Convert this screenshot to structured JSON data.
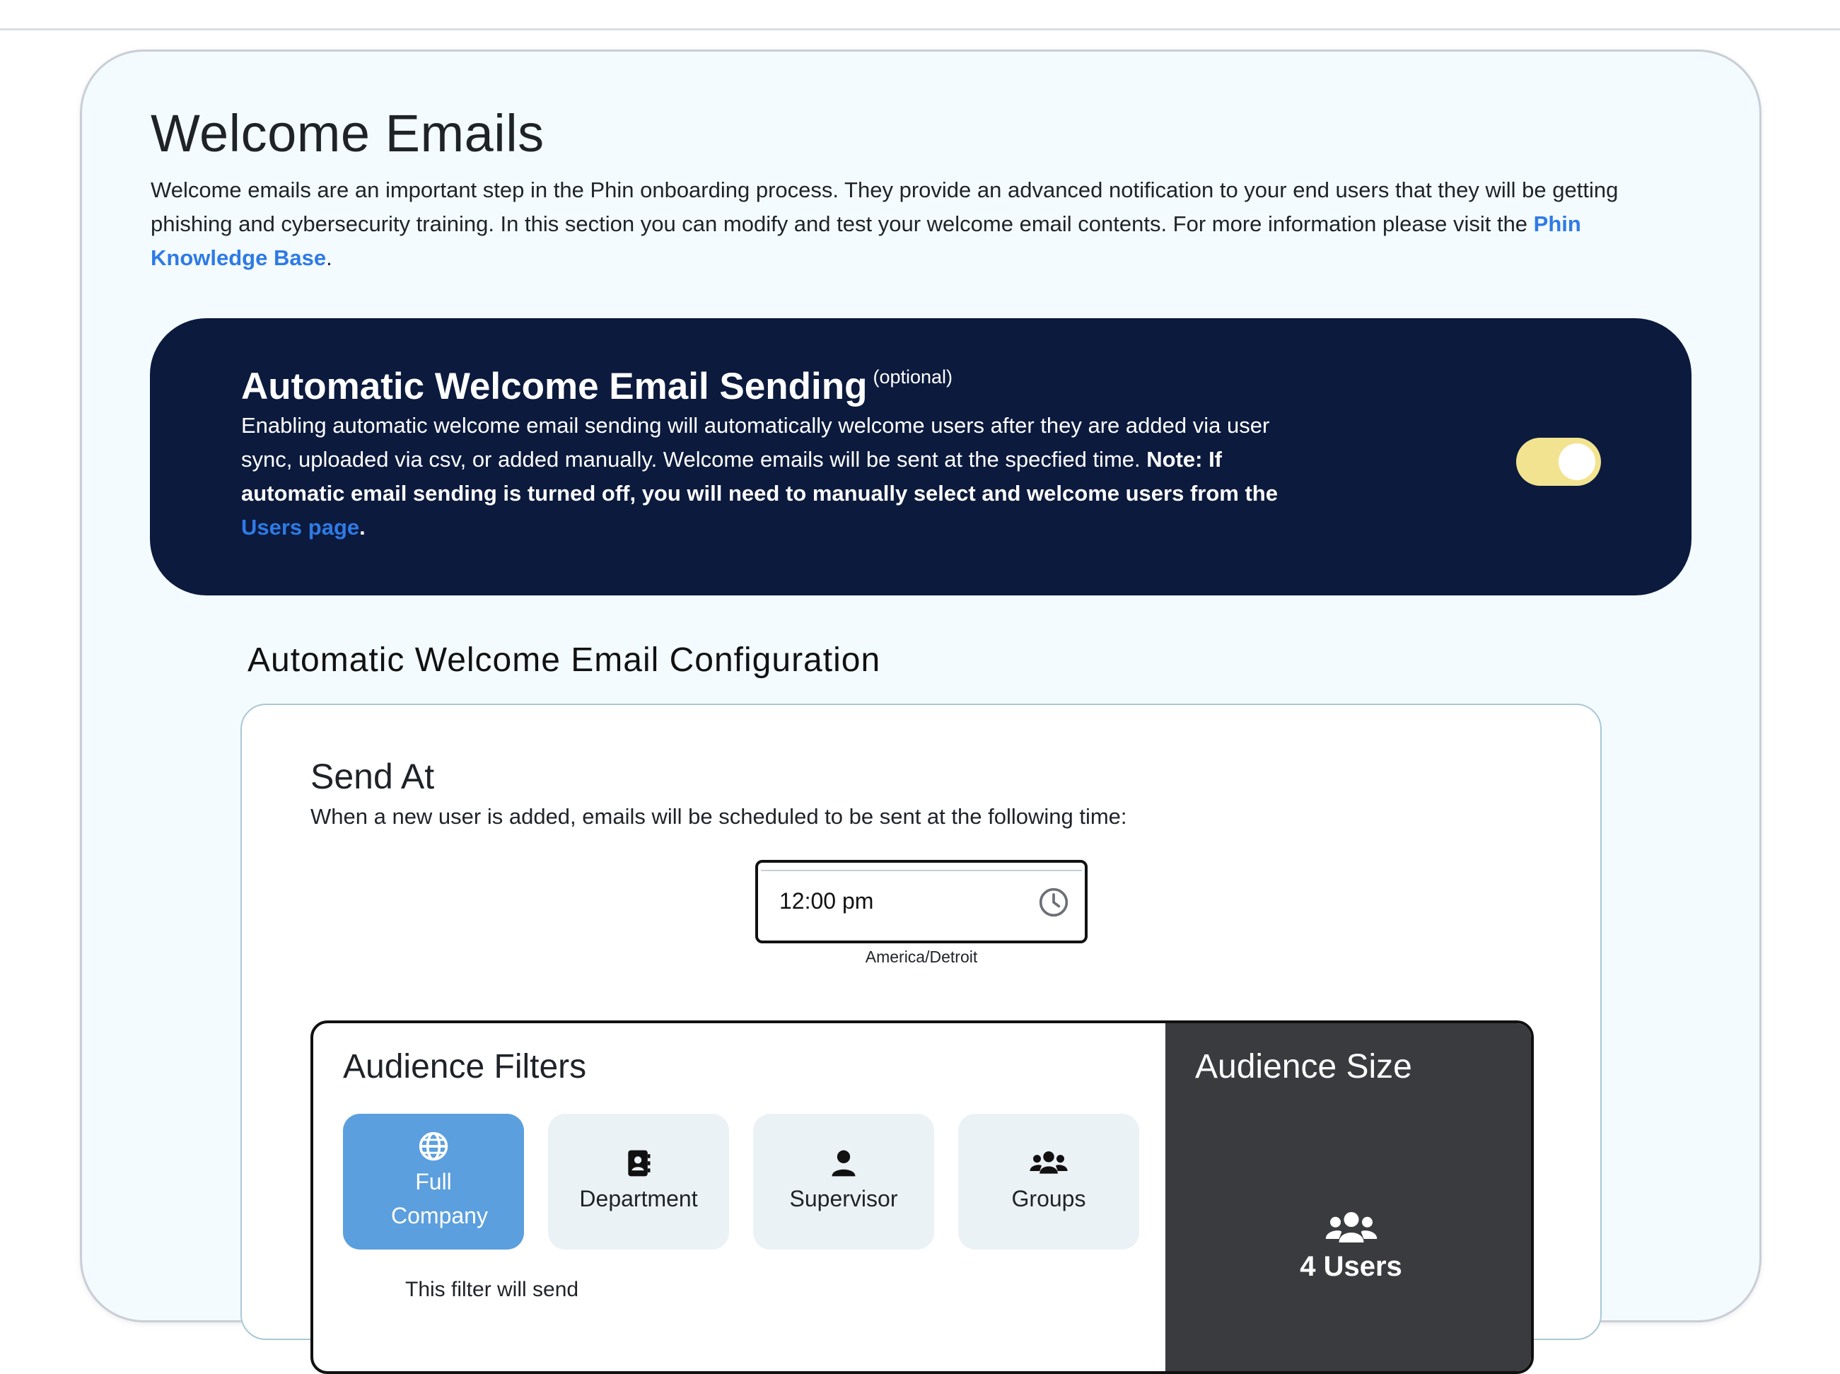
{
  "page": {
    "title": "Welcome Emails",
    "intro_text": "Welcome emails are an important step in the Phin onboarding process. They provide an advanced notification to your end users that they will be getting phishing and cybersecurity training. In this section you can modify and test your welcome email contents. For more information please visit the ",
    "intro_link": "Phin Knowledge Base",
    "intro_end": "."
  },
  "banner": {
    "title": "Automatic Welcome Email Sending",
    "optional": "(optional)",
    "text": "Enabling automatic welcome email sending will automatically welcome users after they are added via user sync, uploaded via csv, or added manually. Welcome emails will be sent at the specfied time. ",
    "note_label": "Note:",
    "note_text": " If automatic email sending is turned off, you will need to manually select and welcome users from the ",
    "users_link": "Users page",
    "end": ".",
    "toggle_on": true,
    "colors": {
      "background": "#0b1a3d",
      "toggle": "#f2e390"
    }
  },
  "config": {
    "title": "Automatic Welcome Email Configuration",
    "send_at": {
      "title": "Send At",
      "description": "When a new user is added, emails will be scheduled to be sent at the following time:",
      "time_value": "12:00 pm",
      "timezone": "America/Detroit"
    },
    "audience_filters": {
      "title": "Audience Filters",
      "options": [
        {
          "label": "Full Company",
          "icon": "globe-icon",
          "active": true
        },
        {
          "label": "Department",
          "icon": "address-book-icon",
          "active": false
        },
        {
          "label": "Supervisor",
          "icon": "user-icon",
          "active": false
        },
        {
          "label": "Groups",
          "icon": "users-icon",
          "active": false
        }
      ],
      "note": "This filter will send"
    },
    "audience_size": {
      "title": "Audience Size",
      "count": "4 Users",
      "icon": "users-icon"
    }
  }
}
